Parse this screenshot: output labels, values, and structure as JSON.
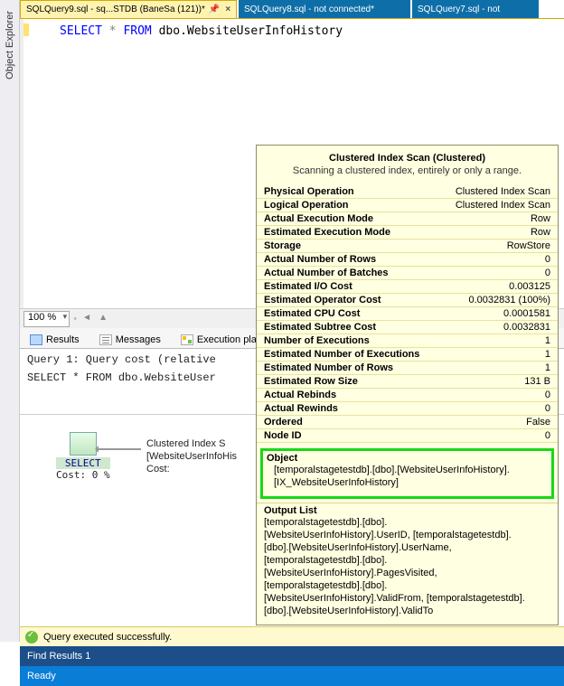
{
  "sidebar": {
    "label": "Object Explorer"
  },
  "tabs": [
    {
      "label": "SQLQuery9.sql - sq...STDB (BaneSa (121))*",
      "active": true
    },
    {
      "label": "SQLQuery8.sql - not connected*",
      "active": false
    },
    {
      "label": "SQLQuery7.sql - not",
      "active": false
    }
  ],
  "code": {
    "kw_select": "SELECT",
    "star": "*",
    "kw_from": "FROM",
    "obj": "dbo.WebsiteUserInfoHistory"
  },
  "zoom": {
    "value": "100 %"
  },
  "result_tabs": {
    "results": "Results",
    "messages": "Messages",
    "plan": "Execution plan"
  },
  "plan_header": {
    "line1": "Query 1: Query cost (relative",
    "line2": "SELECT * FROM dbo.WebsiteUser"
  },
  "node_select": {
    "label": "SELECT",
    "cost": "Cost: 0 %"
  },
  "node_scan": {
    "l1": "Clustered Index S",
    "l2": "[WebsiteUserInfoHis",
    "l3": "Cost: "
  },
  "status": {
    "text": "Query executed successfully."
  },
  "find": {
    "label": "Find Results 1"
  },
  "ready": {
    "label": "Ready"
  },
  "tooltip": {
    "title": "Clustered Index Scan (Clustered)",
    "subtitle": "Scanning a clustered index, entirely or only a range.",
    "rows": [
      {
        "k": "Physical Operation",
        "v": "Clustered Index Scan"
      },
      {
        "k": "Logical Operation",
        "v": "Clustered Index Scan"
      },
      {
        "k": "Actual Execution Mode",
        "v": "Row"
      },
      {
        "k": "Estimated Execution Mode",
        "v": "Row"
      },
      {
        "k": "Storage",
        "v": "RowStore"
      },
      {
        "k": "Actual Number of Rows",
        "v": "0"
      },
      {
        "k": "Actual Number of Batches",
        "v": "0"
      },
      {
        "k": "Estimated I/O Cost",
        "v": "0.003125"
      },
      {
        "k": "Estimated Operator Cost",
        "v": "0.0032831 (100%)"
      },
      {
        "k": "Estimated CPU Cost",
        "v": "0.0001581"
      },
      {
        "k": "Estimated Subtree Cost",
        "v": "0.0032831"
      },
      {
        "k": "Number of Executions",
        "v": "1"
      },
      {
        "k": "Estimated Number of Executions",
        "v": "1"
      },
      {
        "k": "Estimated Number of Rows",
        "v": "1"
      },
      {
        "k": "Estimated Row Size",
        "v": "131 B"
      },
      {
        "k": "Actual Rebinds",
        "v": "0"
      },
      {
        "k": "Actual Rewinds",
        "v": "0"
      },
      {
        "k": "Ordered",
        "v": "False"
      },
      {
        "k": "Node ID",
        "v": "0"
      }
    ],
    "object_hdr": "Object",
    "object_lines": [
      "[temporalstagetestdb].[dbo].[WebsiteUserInfoHistory].",
      "[IX_WebsiteUserInfoHistory]"
    ],
    "output_hdr": "Output List",
    "output_lines": [
      "[temporalstagetestdb].[dbo].",
      "[WebsiteUserInfoHistory].UserID, [temporalstagetestdb].",
      "[dbo].[WebsiteUserInfoHistory].UserName,",
      "[temporalstagetestdb].[dbo].",
      "[WebsiteUserInfoHistory].PagesVisited,",
      "[temporalstagetestdb].[dbo].",
      "[WebsiteUserInfoHistory].ValidFrom, [temporalstagetestdb].",
      "[dbo].[WebsiteUserInfoHistory].ValidTo"
    ]
  }
}
